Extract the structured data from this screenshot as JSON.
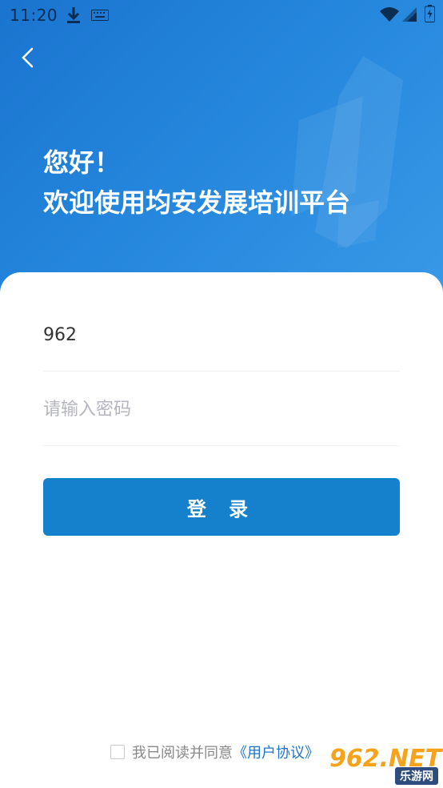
{
  "status_bar": {
    "time": "11:20",
    "icons": [
      "download-icon",
      "keyboard-icon",
      "wifi-icon",
      "signal-icon",
      "battery-icon"
    ]
  },
  "header": {
    "back_icon": "back-arrow-icon",
    "greeting_line1": "您好！",
    "greeting_line2": "欢迎使用均安发展培训平台"
  },
  "form": {
    "account_value": "962",
    "password_placeholder": "请输入密码",
    "login_label": "登 录"
  },
  "agreement": {
    "checked": false,
    "text": "我已阅读并同意",
    "link": "《用户协议》"
  },
  "watermark": {
    "main": "962.NET",
    "sub": "乐游网"
  },
  "colors": {
    "hero_start": "#1a74cf",
    "hero_end": "#3a9ae8",
    "primary_button": "#1580cc",
    "link": "#1d74c8",
    "placeholder": "#b5b5c0"
  }
}
